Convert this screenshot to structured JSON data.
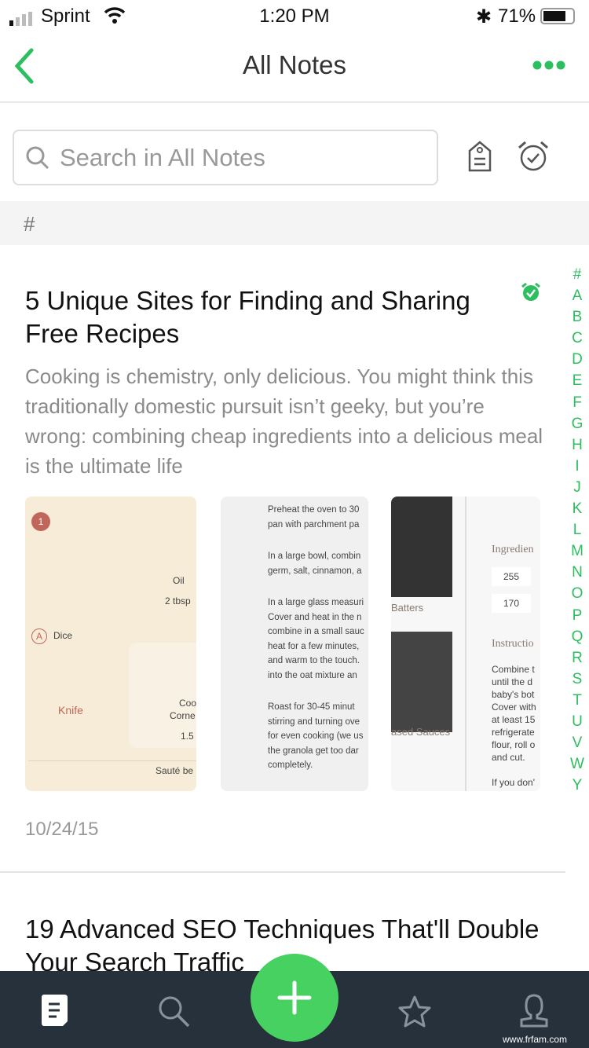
{
  "status": {
    "carrier": "Sprint",
    "time": "1:20 PM",
    "battery": "71%",
    "battery_level": 0.71
  },
  "nav": {
    "title": "All Notes",
    "back_icon": "chevron-left-icon",
    "more_icon": "ellipsis-icon"
  },
  "search": {
    "placeholder": "Search in All Notes"
  },
  "section": "#",
  "notes": [
    {
      "title": "5 Unique Sites for Finding and Sharing Free Recipes",
      "preview": "Cooking is chemistry, only delicious. You might think this traditionally domestic pursuit isn’t geeky, but you’re wrong: combining cheap ingredients into a delicious meal is the ultimate life",
      "date": "10/24/15",
      "thumbs": [
        {
          "labels": [
            "1",
            "Oil",
            "2 tbsp",
            "A",
            "Dice",
            "Knife",
            "Coo",
            "Corne",
            "1.5",
            "Sauté be"
          ]
        },
        {
          "lines": [
            "Preheat the oven to 30",
            "pan with parchment pa",
            "In a large bowl, combin",
            "germ, salt, cinnamon, a",
            "In a large glass measuri",
            "Cover and heat in the n",
            "combine in a small sauc",
            "heat for a few minutes,",
            "and warm to the touch.",
            "into the oat mixture an",
            "Roast for 30-45 minut",
            "stirring and turning ove",
            "for even cooking (we us",
            "the granola get too dar",
            "completely."
          ]
        },
        {
          "labels": [
            "Batters",
            "ased Sauces",
            "Ingredien",
            "255",
            "170",
            "Instructio",
            "Combine t",
            "until the d",
            "baby's bot",
            "Cover with",
            "at least 15",
            "refrigerate",
            "flour, roll o",
            "and cut.",
            "If you don'"
          ]
        }
      ]
    },
    {
      "title": "19 Advanced SEO Techniques That'll Double Your Search Traffic"
    }
  ],
  "index": [
    "#",
    "A",
    "B",
    "C",
    "D",
    "E",
    "F",
    "G",
    "H",
    "I",
    "J",
    "K",
    "L",
    "M",
    "N",
    "O",
    "P",
    "Q",
    "R",
    "S",
    "T",
    "U",
    "V",
    "W",
    "Y"
  ],
  "tabs": [
    "notes-icon",
    "search-icon",
    "plus-icon",
    "star-icon",
    "account-icon"
  ],
  "watermark": "www.frfam.com",
  "colors": {
    "accent": "#2dbe60",
    "tabbar": "#27313b",
    "fab": "#46d160"
  }
}
